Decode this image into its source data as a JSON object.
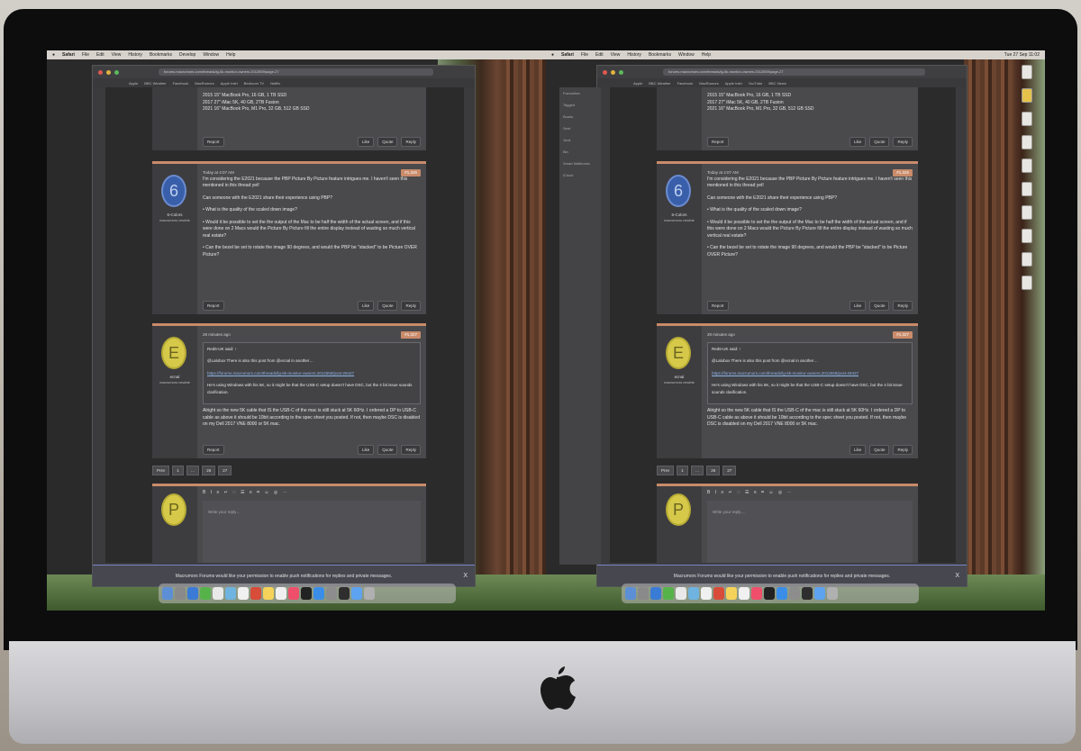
{
  "screen": {
    "menubar": {
      "app": "Safari",
      "items": [
        "File",
        "Edit",
        "View",
        "History",
        "Bookmarks",
        "Develop",
        "Window",
        "Help"
      ],
      "clock": "Tue 27 Sep 11:02"
    },
    "browser": {
      "url": "forums.macrumors.com/threads/lg-5k-monitor-owners.2012559/page-27",
      "bookmarks": [
        "Apple",
        "BBC Weather",
        "Facebook",
        "MacRumors",
        "Apple Intel",
        "Bedroom TV",
        "Netflix",
        "YouTube",
        "BBC News"
      ],
      "sidebar": [
        "Favourites",
        "Tagged",
        "Books",
        "Sent",
        "Junk",
        "Bin",
        "Smart Mailboxes",
        "iCloud"
      ],
      "prev_post_tail": "2015 15\" MacBook Pro, 16 GB, 1 TB SSD\n2017 27\" iMac 5K, 40 GB, 2TB Fusion\n2021 16\" MacBook Pro, M1 Pro, 32 GB, 512 GB SSD"
    },
    "posts": [
      {
        "timestamp": "Today at 4:07 AM",
        "post_number": "#1,326",
        "avatar_letter": "6",
        "username": "6-Colors",
        "status": "macrumors newbie",
        "paragraphs": [
          "I'm considering the E2021 because the PBP Picture By Picture feature intrigues me. I haven't seen this mentioned in this thread yet!",
          "Can someone with the E2021 share their experience using PBP?",
          "• What is the quality of the scaled down image?",
          "• Would it be possible to set the the output of the Mac to be half the width of the actual screen, and if this were done on 2 Macs would the Picture By Picture fill the entire display instead of wasting so much vertical real estate?",
          "• Can the bezel be set to rotate the image 90 degrees, and would the PBP be \"stacked\" to be Picture OVER Picture?"
        ]
      },
      {
        "timestamp": "28 minutes ago",
        "post_number": "#1,327",
        "avatar_letter": "E",
        "username": "ecnal",
        "status": "macrumors newbie",
        "quote_header": "Red6-UK said: ↑",
        "quote_text": "@Lalobox There is also this post from @ecnal in another…",
        "quote_link": "https://forums.macrumors.com/threads/lg-5k-monitor-owners.2012559/post-29427",
        "quote_footer": "He's using Windows with his 5K, so it might be that the USB-C setup doesn't have DSC, but the 4 bit issue sounds clarification.",
        "reply": "Alright so the new 5K cable that IS the USB-C of the mac is still stuck at 5K 60Hz. I ordered a DP to USB-C cable as above it should be 10bit according to the spec sheet you posted. If not, then maybe DSC is disabled on my Dell 2017 VNE 8000 or 5K mac."
      }
    ],
    "actions": [
      "Like",
      "Quote",
      "Reply"
    ],
    "report_label": "Report",
    "pagination": [
      "Prev",
      "1",
      "…",
      "26",
      "27"
    ],
    "editor": {
      "toolbar": "B I ≡ ↵ ∷ ☰ ≡ ⌗ ☺ ◎ ⋯",
      "placeholder": "Write your reply…",
      "avatar_letter": "P"
    },
    "notification": {
      "text": "Macrumors Forums would like your permission to enable push notifications for replies and private messages.",
      "close": "X"
    }
  }
}
